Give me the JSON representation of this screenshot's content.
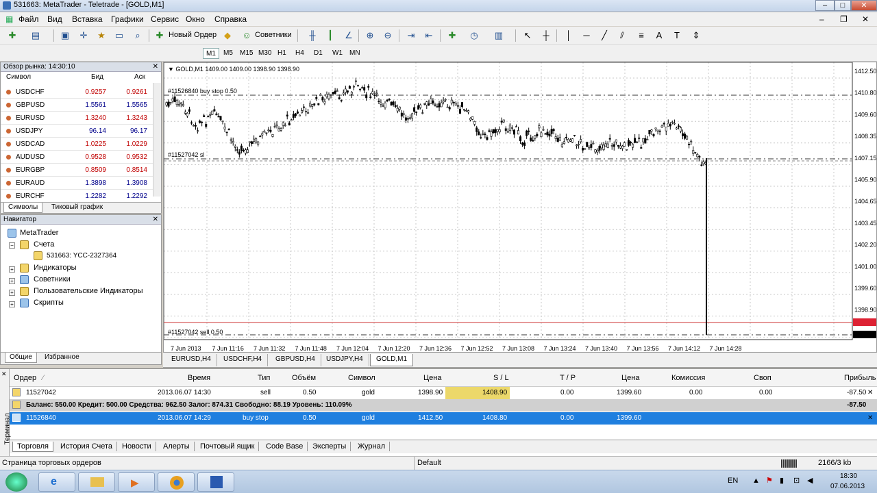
{
  "window": {
    "title": "531663: MetaTrader - Teletrade - [GOLD,M1]"
  },
  "menu": [
    "Файл",
    "Вид",
    "Вставка",
    "Графики",
    "Сервис",
    "Окно",
    "Справка"
  ],
  "toolbar": {
    "new_order": "Новый Ордер",
    "experts": "Советники"
  },
  "timeframes": [
    "M1",
    "M5",
    "M15",
    "M30",
    "H1",
    "H4",
    "D1",
    "W1",
    "MN"
  ],
  "market_watch": {
    "title": "Обзор рынка: 14:30:10",
    "headers": {
      "symbol": "Символ",
      "bid": "Бид",
      "ask": "Аск"
    },
    "rows": [
      {
        "symbol": "USDCHF",
        "bid": "0.9257",
        "ask": "0.9261",
        "up": false
      },
      {
        "symbol": "GBPUSD",
        "bid": "1.5561",
        "ask": "1.5565",
        "up": true
      },
      {
        "symbol": "EURUSD",
        "bid": "1.3240",
        "ask": "1.3243",
        "up": false
      },
      {
        "symbol": "USDJPY",
        "bid": "96.14",
        "ask": "96.17",
        "up": true
      },
      {
        "symbol": "USDCAD",
        "bid": "1.0225",
        "ask": "1.0229",
        "up": false
      },
      {
        "symbol": "AUDUSD",
        "bid": "0.9528",
        "ask": "0.9532",
        "up": false
      },
      {
        "symbol": "EURGBP",
        "bid": "0.8509",
        "ask": "0.8514",
        "up": false
      },
      {
        "symbol": "EURAUD",
        "bid": "1.3898",
        "ask": "1.3908",
        "up": true
      },
      {
        "symbol": "EURCHF",
        "bid": "1.2282",
        "ask": "1.2292",
        "up": true
      }
    ],
    "tabs": [
      "Символы",
      "Тиковый график"
    ]
  },
  "navigator": {
    "title": "Навигатор",
    "root": "MetaTrader",
    "accounts": "Счета",
    "account": "531663: YCC-2327364",
    "items": [
      "Индикаторы",
      "Советники",
      "Пользовательские Индикаторы",
      "Скрипты"
    ],
    "tabs": [
      "Общие",
      "Избранное"
    ]
  },
  "chart": {
    "header": "GOLD,M1  1409.00 1409.00 1398.90 1398.90",
    "labels": {
      "buy_stop": "#11526840 buy stop 0.50",
      "sl": "#11527042 sl",
      "sell": "#11527042 sell 0.50"
    },
    "price_labels": [
      "1412.50",
      "1410.80",
      "1409.60",
      "1408.35",
      "1407.15",
      "1405.90",
      "1404.65",
      "1403.45",
      "1402.20",
      "1401.00",
      "1399.60",
      "1398.90"
    ],
    "time_labels": [
      "7 Jun 2013",
      "7 Jun 11:16",
      "7 Jun 11:32",
      "7 Jun 11:48",
      "7 Jun 12:04",
      "7 Jun 12:20",
      "7 Jun 12:36",
      "7 Jun 12:52",
      "7 Jun 13:08",
      "7 Jun 13:24",
      "7 Jun 13:40",
      "7 Jun 13:56",
      "7 Jun 14:12",
      "7 Jun 14:28"
    ],
    "tabs": [
      "EURUSD,H4",
      "USDCHF,H4",
      "GBPUSD,H4",
      "USDJPY,H4",
      "GOLD,M1"
    ]
  },
  "terminal": {
    "side_label": "Терминал",
    "headers": [
      "Ордер",
      "Время",
      "Тип",
      "Объём",
      "Символ",
      "Цена",
      "S / L",
      "T / P",
      "Цена",
      "Комиссия",
      "Своп",
      "Прибыль"
    ],
    "order": [
      "11527042",
      "2013.06.07 14:30",
      "sell",
      "0.50",
      "gold",
      "1398.90",
      "1408.90",
      "0.00",
      "1399.60",
      "0.00",
      "0.00",
      "-87.50"
    ],
    "balance": "Баланс: 550.00  Кредит: 500.00  Средства: 962.50  Залог: 874.31  Свободно: 88.19  Уровень: 110.09%",
    "balance_profit": "-87.50",
    "pending": [
      "11526840",
      "2013.06.07 14:29",
      "buy stop",
      "0.50",
      "gold",
      "1412.50",
      "1408.80",
      "0.00",
      "1399.60"
    ],
    "tabs": [
      "Торговля",
      "История Счета",
      "Новости",
      "Алерты",
      "Почтовый ящик",
      "Code Base",
      "Эксперты",
      "Журнал"
    ]
  },
  "status": {
    "left": "Страница торговых ордеров",
    "profile": "Default",
    "traffic": "2166/3 kb"
  },
  "taskbar": {
    "lang": "EN",
    "time": "18:30",
    "date": "07.06.2013"
  }
}
